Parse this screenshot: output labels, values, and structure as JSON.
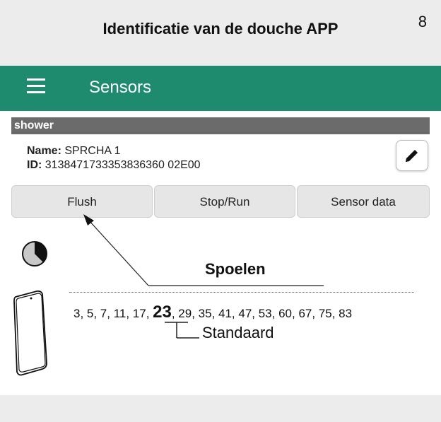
{
  "header": {
    "title": "Identificatie van de douche APP",
    "page_number": "8"
  },
  "app": {
    "menu_icon": "hamburger-menu-icon",
    "title": "Sensors",
    "accent_color": "#1e8a6e"
  },
  "sensor_group": {
    "label": "shower",
    "name_label": "Name:",
    "name_value": "SPRCHA 1",
    "id_label": "ID:",
    "id_value": "3138471733353836360 02E00",
    "edit_icon": "pencil-icon"
  },
  "buttons": {
    "flush": "Flush",
    "stop_run": "Stop/Run",
    "sensor_data": "Sensor data"
  },
  "annotation": {
    "callout": "Spoelen",
    "sequence_before": "3, 5, 7, 11, 17, ",
    "sequence_highlight": "23",
    "sequence_after": ", 29, 35, 41, 47, 53, 60, 67, 75, 83",
    "default_label": "Standaard"
  }
}
